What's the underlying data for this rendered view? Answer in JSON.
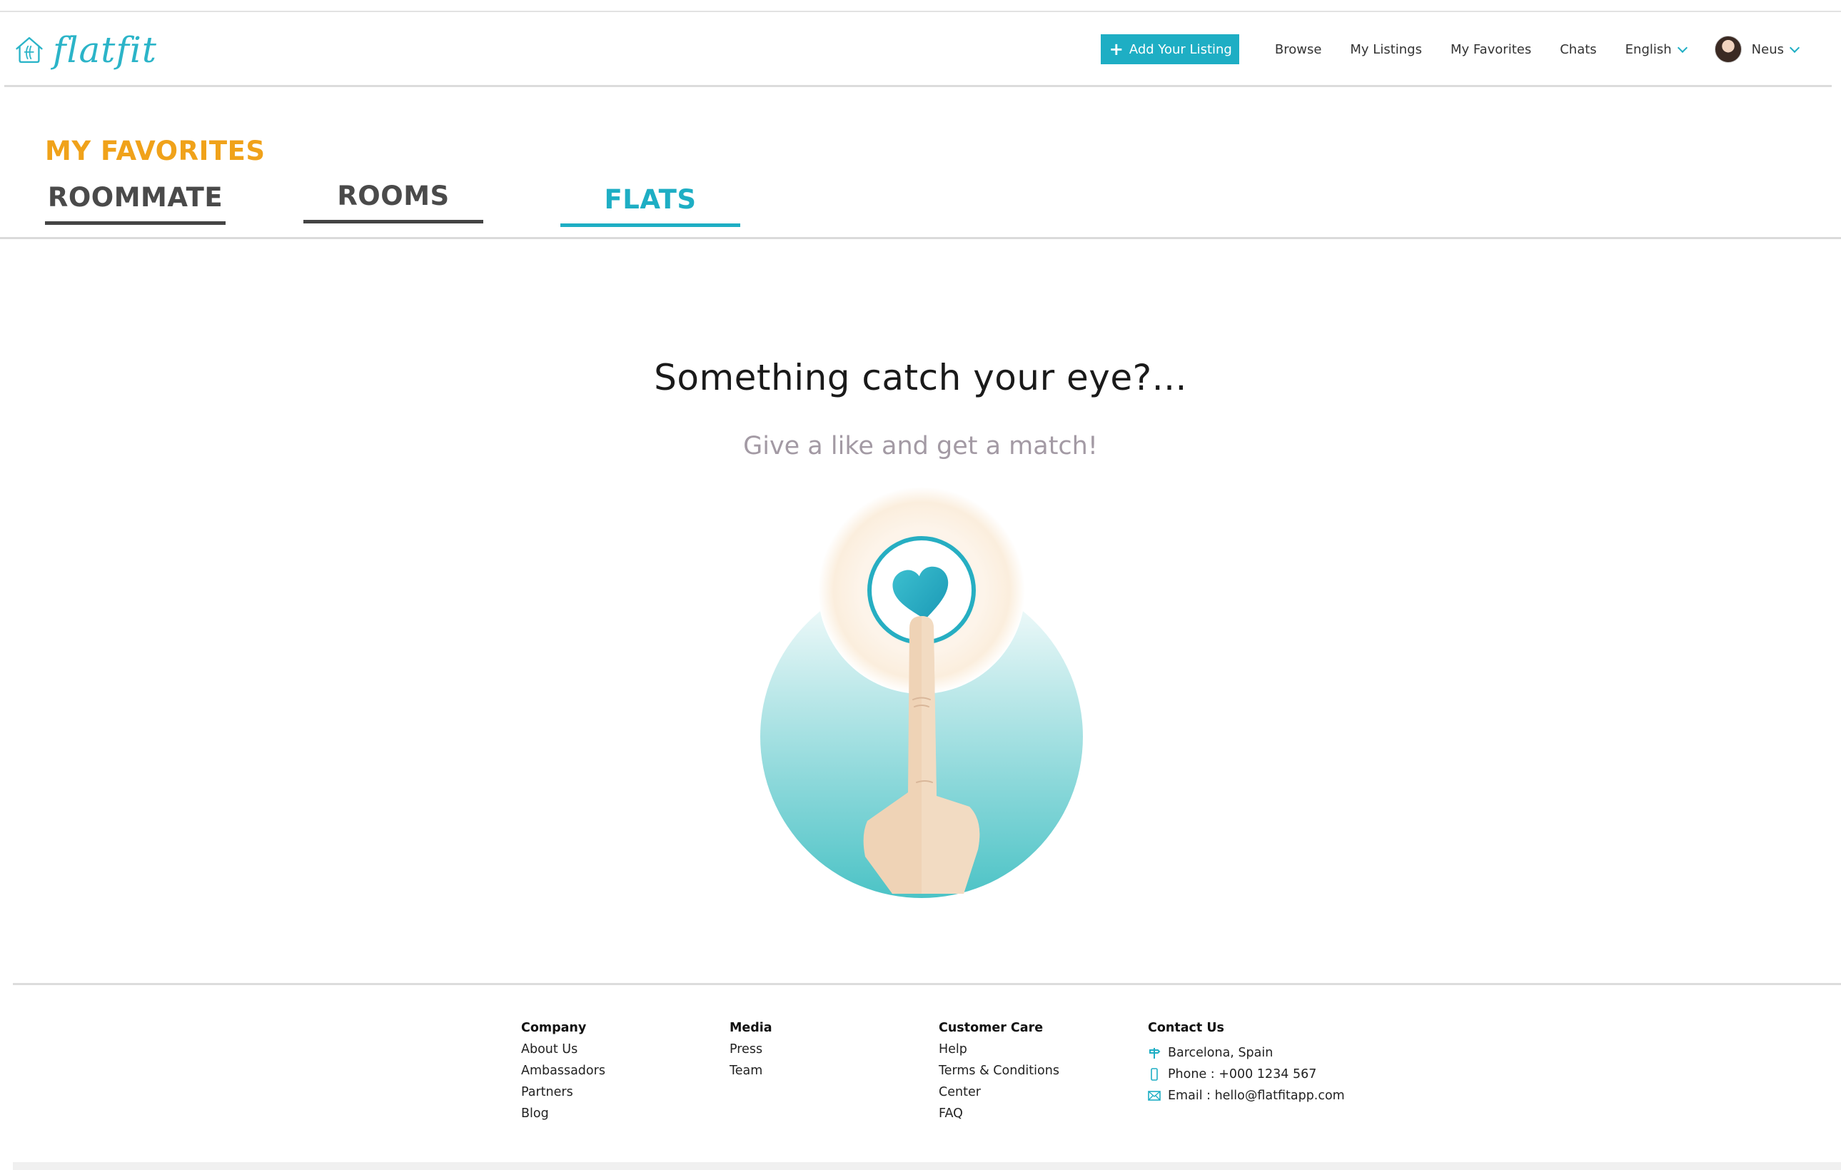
{
  "brand": {
    "name": "flatfit",
    "accent": "#1eaec4",
    "title_color": "#f0a21a"
  },
  "nav": {
    "add_listing": "Add Your Listing",
    "links": [
      "Browse",
      "My Listings",
      "My Favorites",
      "Chats"
    ],
    "language": "English",
    "user": "Neus"
  },
  "page": {
    "title": "MY FAVORITES",
    "tabs": [
      {
        "label": "ROOMMATE",
        "active": false
      },
      {
        "label": "ROOMS",
        "active": false
      },
      {
        "label": "FLATS",
        "active": true
      }
    ]
  },
  "empty_state": {
    "title": "Something catch your eye?...",
    "subtitle": "Give a like and get a match!",
    "icon": "heart-tap-icon"
  },
  "footer": {
    "company": {
      "title": "Company",
      "links": [
        "About Us",
        "Ambassadors",
        "Partners",
        "Blog"
      ]
    },
    "media": {
      "title": "Media",
      "links": [
        "Press",
        "Team"
      ]
    },
    "care": {
      "title": "Customer Care",
      "links": [
        "Help",
        "Terms & Conditions",
        "Center",
        "FAQ"
      ]
    },
    "contact": {
      "title": "Contact Us",
      "location": "Barcelona, Spain",
      "phone": "Phone : +000 1234 567",
      "email": "Email : hello@flatfitapp.com"
    }
  }
}
